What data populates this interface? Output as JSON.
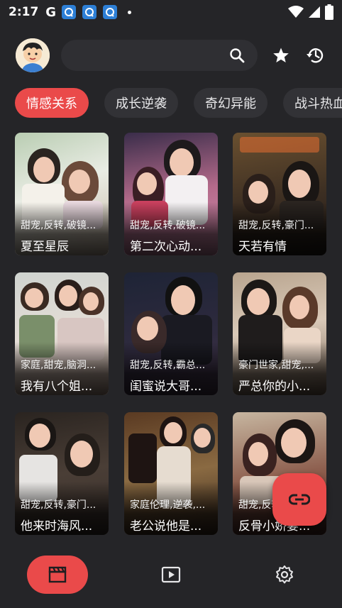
{
  "status_bar": {
    "time": "2:17",
    "g_label": "G"
  },
  "header": {
    "search": {
      "placeholder": ""
    },
    "icons": [
      "search-icon",
      "star-icon",
      "history-icon"
    ]
  },
  "tabs": [
    {
      "label": "情感关系",
      "active": true
    },
    {
      "label": "成长逆袭",
      "active": false
    },
    {
      "label": "奇幻异能",
      "active": false
    },
    {
      "label": "战斗热血",
      "active": false
    }
  ],
  "dramas": [
    {
      "tags": "甜宠,反转,破镜...",
      "title": "夏至星辰"
    },
    {
      "tags": "甜宠,反转,破镜...",
      "title": "第二次心动..."
    },
    {
      "tags": "甜宠,反转,豪门...",
      "title": "天若有情"
    },
    {
      "tags": "家庭,甜宠,脑洞...",
      "title": "我有八个姐..."
    },
    {
      "tags": "甜宠,反转,霸总...",
      "title": "闺蜜说大哥..."
    },
    {
      "tags": "豪门世家,甜宠,...",
      "title": "严总你的小..."
    },
    {
      "tags": "甜宠,反转,豪门...",
      "title": "他来时海风..."
    },
    {
      "tags": "家庭伦理,逆袭,...",
      "title": "老公说他是..."
    },
    {
      "tags": "甜宠,反转,豪门...",
      "title": "反骨小娇妻..."
    }
  ],
  "fab": {
    "icon": "link-icon"
  },
  "bottom_nav": [
    {
      "icon": "clapperboard-icon",
      "active": true
    },
    {
      "icon": "play-icon",
      "active": false
    },
    {
      "icon": "gear-icon",
      "active": false
    }
  ],
  "colors": {
    "background": "#252528",
    "accent": "#ea4a4a",
    "chip": "#323236",
    "search": "#2f2f33"
  }
}
